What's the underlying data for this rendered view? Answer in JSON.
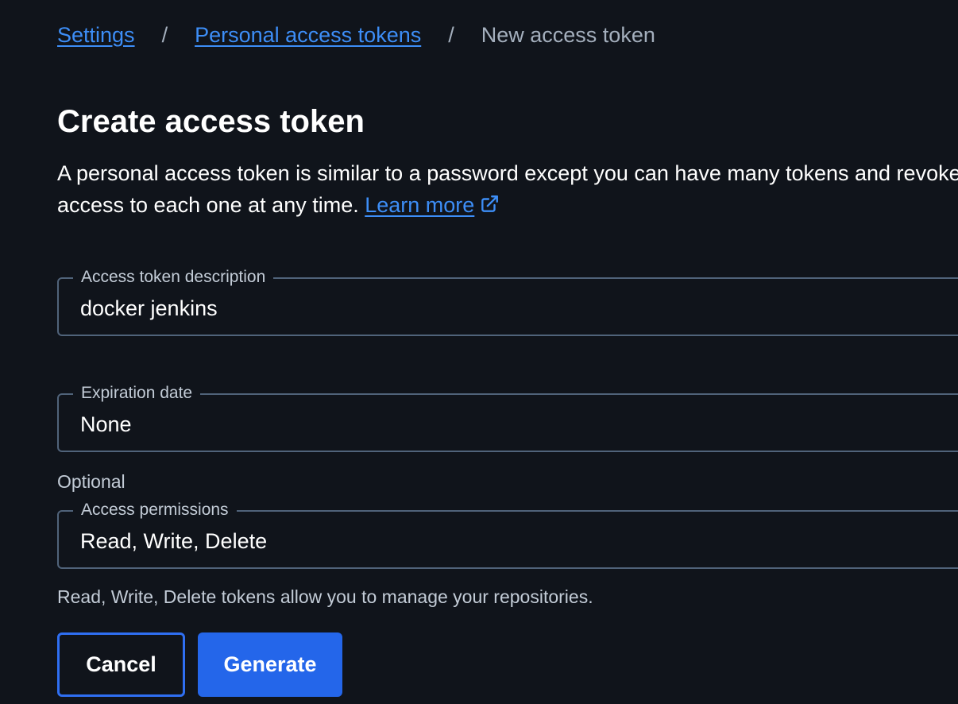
{
  "breadcrumb": {
    "settings": "Settings",
    "separator": "/",
    "tokens": "Personal access tokens",
    "current": "New access token"
  },
  "page": {
    "title": "Create access token",
    "description": "A personal access token is similar to a password except you can have many tokens and revoke access to each one at any time.",
    "learn_more": "Learn more"
  },
  "form": {
    "description_field": {
      "label": "Access token description",
      "value": "docker jenkins"
    },
    "expiration_field": {
      "label": "Expiration date",
      "value": "None",
      "helper": "Optional"
    },
    "permissions_field": {
      "label": "Access permissions",
      "value": "Read, Write, Delete",
      "helper": "Read, Write, Delete tokens allow you to manage your repositories."
    }
  },
  "actions": {
    "cancel": "Cancel",
    "generate": "Generate"
  },
  "icons": {
    "learn_more": "external-link-icon"
  },
  "colors": {
    "background": "#10141b",
    "link": "#3d8ef7",
    "primary_button": "#2466ea",
    "field_border": "#50637a",
    "muted_text": "#c3ccd7"
  }
}
